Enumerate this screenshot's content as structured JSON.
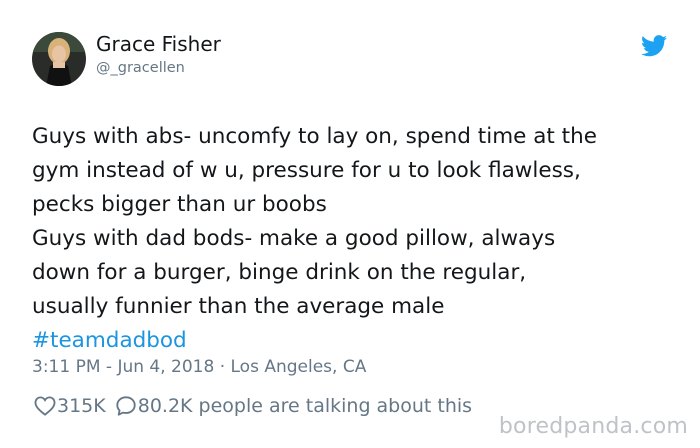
{
  "tweet": {
    "author_name": "Grace Fisher",
    "author_handle": "@_gracellen",
    "body_lines": [
      "Guys with abs- uncomfy to lay on, spend time at the",
      "gym instead of w u, pressure for u to look flawless,",
      "pecks bigger than ur boobs",
      "Guys with dad bods- make a good pillow, always",
      "down for a burger, binge drink on the regular,",
      "usually funnier than the average male"
    ],
    "hashtag": "#teamdadbod",
    "timestamp": "3:11 PM - Jun 4, 2018 · Los Angeles, CA",
    "likes": "315K",
    "comments": "80.2K people are talking about this",
    "icons": {
      "brand": "twitter-bird-icon",
      "like": "heart-icon",
      "comment": "speech-bubble-icon"
    },
    "colors": {
      "brand_blue": "#1da1f2",
      "hashtag_blue": "#1b95e0",
      "text": "#14171a",
      "muted": "#657786"
    }
  },
  "watermark": "boredpanda.com"
}
